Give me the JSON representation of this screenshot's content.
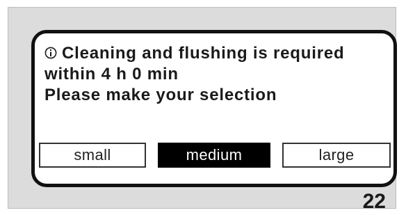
{
  "display": {
    "icon": "info-icon",
    "message_lines": [
      "Cleaning and flushing is required",
      "within 4 h 0 min",
      "Please make your selection"
    ],
    "options": [
      {
        "label": "small",
        "selected": false
      },
      {
        "label": "medium",
        "selected": true
      },
      {
        "label": "large",
        "selected": false
      }
    ]
  },
  "figure_number": "22",
  "colors": {
    "frame_bg": "#dcdcdc",
    "display_border": "#111111",
    "selected_bg": "#000000",
    "selected_text": "#ffffff"
  }
}
